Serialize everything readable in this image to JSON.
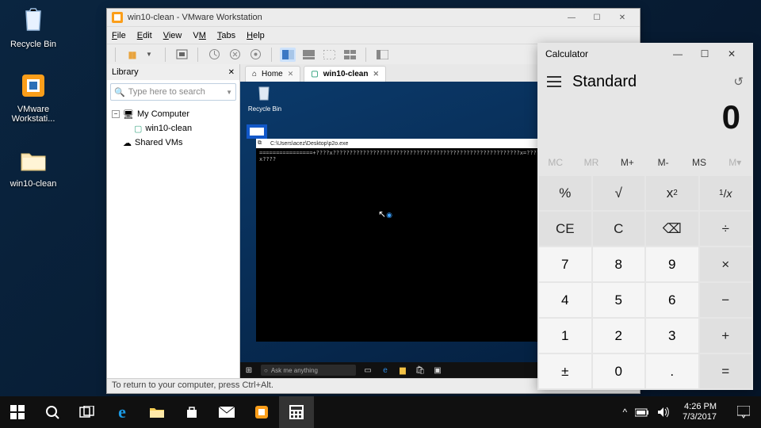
{
  "desktop": {
    "icons": [
      {
        "name": "recycle-bin",
        "label": "Recycle Bin"
      },
      {
        "name": "vmware-app",
        "label": "VMware Workstati..."
      },
      {
        "name": "vm-folder",
        "label": "win10-clean"
      }
    ]
  },
  "vmware": {
    "title": "win10-clean - VMware Workstation",
    "menu": [
      "File",
      "Edit",
      "View",
      "VM",
      "Tabs",
      "Help"
    ],
    "library": {
      "title": "Library",
      "search_placeholder": "Type here to search",
      "tree": {
        "root": "My Computer",
        "child": "win10-clean",
        "shared": "Shared VMs"
      }
    },
    "tabs": {
      "home": "Home",
      "active": "win10-clean"
    },
    "guest_icon": "Recycle Bin",
    "cmd_title": "C:\\Users\\acez\\Desktop\\p2o.exe",
    "cmd_text": "================+????x????????????????????????????????????????????????????????x=??????=??????????????????????x????",
    "guest_search": "Ask me anything",
    "status": "To return to your computer, press Ctrl+Alt."
  },
  "calc": {
    "title": "Calculator",
    "mode": "Standard",
    "display": "0",
    "mem": [
      "MC",
      "MR",
      "M+",
      "M-",
      "MS",
      "M▾"
    ],
    "mem_disabled": [
      0,
      1,
      5
    ],
    "keys": [
      [
        "%",
        "√",
        "x²",
        "¹/x"
      ],
      [
        "CE",
        "C",
        "⌫",
        "÷"
      ],
      [
        "7",
        "8",
        "9",
        "×"
      ],
      [
        "4",
        "5",
        "6",
        "−"
      ],
      [
        "1",
        "2",
        "3",
        "+"
      ],
      [
        "±",
        "0",
        ".",
        "="
      ]
    ],
    "num_cells": [
      "7",
      "8",
      "9",
      "4",
      "5",
      "6",
      "1",
      "2",
      "3",
      "±",
      "0",
      "."
    ]
  },
  "taskbar": {
    "time": "4:26 PM",
    "date": "7/3/2017"
  }
}
